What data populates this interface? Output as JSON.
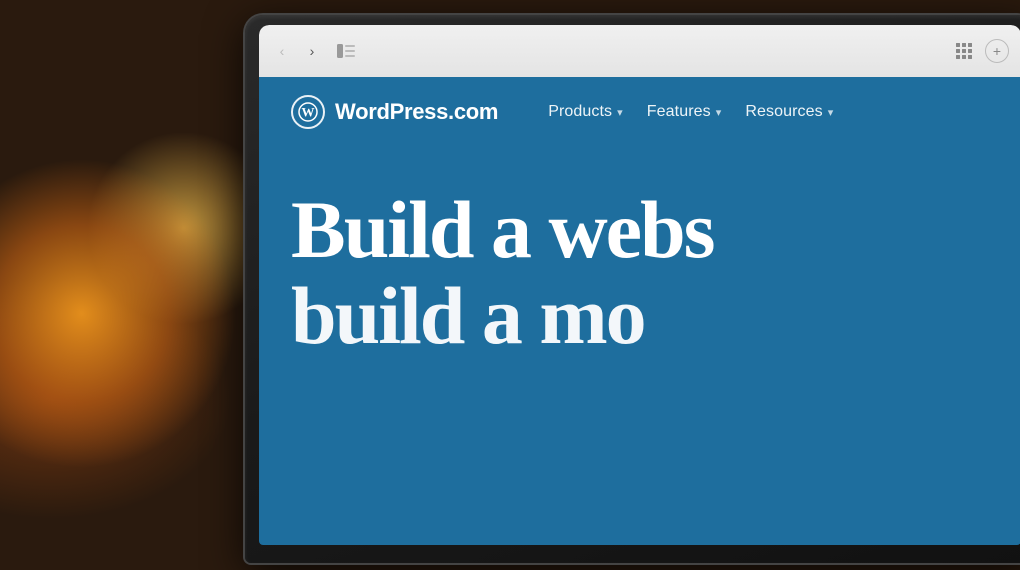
{
  "background": {
    "color": "#2a1a0e"
  },
  "browser": {
    "nav_back_label": "‹",
    "nav_forward_label": "›",
    "sidebar_label": "⊡",
    "tab_grid_label": "grid",
    "new_tab_label": "+"
  },
  "website": {
    "logo_symbol": "W",
    "brand_name": "WordPress.com",
    "nav_items": [
      {
        "label": "Products",
        "has_dropdown": true
      },
      {
        "label": "Features",
        "has_dropdown": true
      },
      {
        "label": "Resources",
        "has_dropdown": true
      }
    ],
    "hero_line1": "Build a webs",
    "hero_line2": "build a mo",
    "background_color": "#1e6e9e"
  }
}
